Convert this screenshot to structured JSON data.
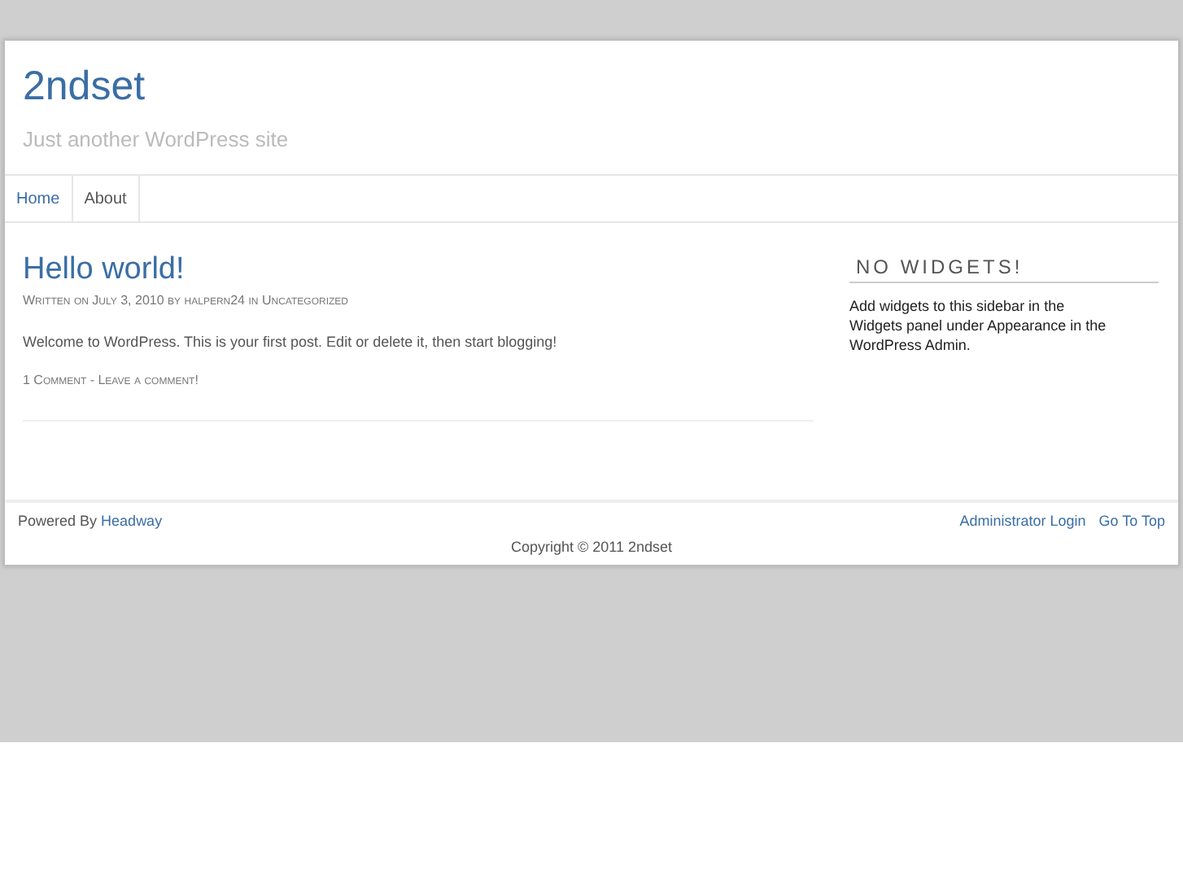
{
  "site": {
    "title": "2ndset",
    "tagline": "Just another WordPress site"
  },
  "nav": [
    {
      "label": "Home",
      "selected": true
    },
    {
      "label": "About",
      "selected": false
    }
  ],
  "post": {
    "title": "Hello world!",
    "byline": {
      "prefix": "Written on July 3, 2010 by",
      "author": "halpern24",
      "middle": "in",
      "category": "Uncategorized"
    },
    "body": "Welcome to WordPress. This is your first post. Edit or delete it, then start blogging!",
    "comments": "1 Comment -",
    "leave_comment": "Leave a comment!"
  },
  "sidebar": {
    "heading": "NO WIDGETS!",
    "text_before": "Add widgets to this sidebar in the",
    "link": "Widgets panel",
    "text_after": "under Appearance in the WordPress Admin."
  },
  "footer": {
    "powered_by": "Powered By",
    "powered_link": "Headway",
    "links": [
      "Administrator Login",
      "Go To Top"
    ],
    "copyright": "Copyright © 2011 2ndset"
  }
}
